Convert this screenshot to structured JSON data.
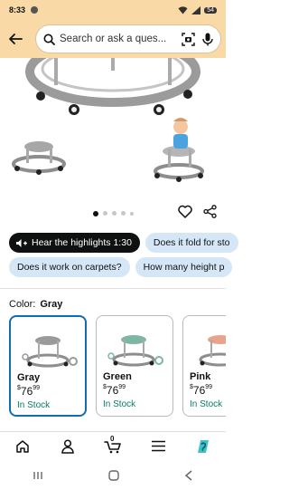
{
  "status_bar": {
    "time": "8:33",
    "battery": "54"
  },
  "search": {
    "placeholder": "Search or ask a ques..."
  },
  "carousel": {
    "total": 5,
    "active_index": 0
  },
  "chips_row1": [
    {
      "label": "Hear the highlights 1:30",
      "style": "dark",
      "icon": "audio-icon"
    },
    {
      "label": "Does it fold for sto",
      "style": "light"
    }
  ],
  "chips_row2": [
    {
      "label": "Does it work on carpets?",
      "style": "light"
    },
    {
      "label": "How many height p",
      "style": "light"
    }
  ],
  "color_selector": {
    "label": "Color:",
    "selected": "Gray"
  },
  "variants": [
    {
      "name": "Gray",
      "currency": "$",
      "price_whole": "76",
      "price_fraction": "99",
      "stock": "In Stock",
      "color": "#9a9a9a",
      "selected": true
    },
    {
      "name": "Green",
      "currency": "$",
      "price_whole": "76",
      "price_fraction": "99",
      "stock": "In Stock",
      "color": "#7fb6a3",
      "selected": false
    },
    {
      "name": "Pink",
      "currency": "$",
      "price_whole": "76",
      "price_fraction": "99",
      "stock": "In Stock",
      "color": "#e7a48a",
      "selected": false
    }
  ],
  "bottom_nav": {
    "items": [
      "home-icon",
      "account-icon",
      "cart-icon",
      "menu-icon",
      "rufus-icon"
    ],
    "cart_count": "0",
    "accent": "#0f8d8f"
  },
  "colors": {
    "header_bg": "#f9d9a6",
    "chip_light": "#d5e7f7",
    "stock_green": "#067d62",
    "selected_border": "#0f6db3"
  }
}
